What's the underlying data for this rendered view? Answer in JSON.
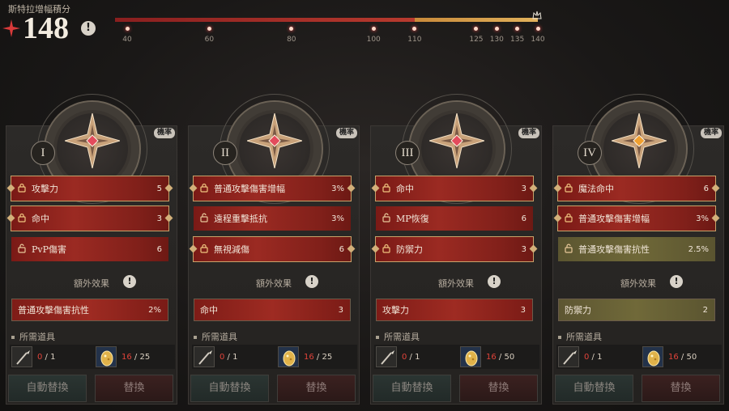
{
  "header": {
    "label": "斯特拉增幅積分",
    "score": "148",
    "info": "!",
    "end_icon": "crown-icon",
    "progress_total": 140,
    "progress_red_until": 110,
    "progress_gold_until": 140,
    "ticks": [
      {
        "label": "40",
        "value": 40
      },
      {
        "label": "60",
        "value": 60
      },
      {
        "label": "80",
        "value": 80
      },
      {
        "label": "100",
        "value": 100
      },
      {
        "label": "110",
        "value": 110
      },
      {
        "label": "125",
        "value": 125
      },
      {
        "label": "130",
        "value": 130
      },
      {
        "label": "135",
        "value": 135
      },
      {
        "label": "140",
        "value": 140
      }
    ],
    "colors": {
      "red": "#9b2a22",
      "gold": "#e2b25c"
    }
  },
  "panels": [
    {
      "roman": "I",
      "prob": "機率",
      "emblem_gem": "#e34b5c",
      "stats": [
        {
          "name": "攻擊力",
          "value": "5",
          "locked": true,
          "style": "red"
        },
        {
          "name": "命中",
          "value": "3",
          "locked": true,
          "style": "red"
        },
        {
          "name": "PvP傷害",
          "value": "6",
          "locked": false,
          "style": "red"
        }
      ],
      "extra_title": "額外效果",
      "extra": {
        "name": "普通攻擊傷害抗性",
        "value": "2%",
        "style": "red"
      },
      "req_title": "所需道具",
      "req": [
        {
          "have": "0",
          "need": "1",
          "icon": "spear-icon"
        },
        {
          "have": "16",
          "need": "25",
          "icon": "gold-egg-icon"
        }
      ],
      "auto_label": "自動替換",
      "swap_label": "替換"
    },
    {
      "roman": "II",
      "prob": "機率",
      "emblem_gem": "#e34b5c",
      "stats": [
        {
          "name": "普通攻擊傷害增幅",
          "value": "3%",
          "locked": true,
          "style": "red"
        },
        {
          "name": "遠程重擊抵抗",
          "value": "3%",
          "locked": false,
          "style": "red"
        },
        {
          "name": "無視減傷",
          "value": "6",
          "locked": true,
          "style": "red"
        }
      ],
      "extra_title": "額外效果",
      "extra": {
        "name": "命中",
        "value": "3",
        "style": "red"
      },
      "req_title": "所需道具",
      "req": [
        {
          "have": "0",
          "need": "1",
          "icon": "spear-icon"
        },
        {
          "have": "16",
          "need": "25",
          "icon": "gold-egg-icon"
        }
      ],
      "auto_label": "自動替換",
      "swap_label": "替換"
    },
    {
      "roman": "III",
      "prob": "機率",
      "emblem_gem": "#e34b5c",
      "stats": [
        {
          "name": "命中",
          "value": "3",
          "locked": true,
          "style": "red"
        },
        {
          "name": "MP恢復",
          "value": "6",
          "locked": false,
          "style": "red"
        },
        {
          "name": "防禦力",
          "value": "3",
          "locked": true,
          "style": "red"
        }
      ],
      "extra_title": "額外效果",
      "extra": {
        "name": "攻擊力",
        "value": "3",
        "style": "red"
      },
      "req_title": "所需道具",
      "req": [
        {
          "have": "0",
          "need": "1",
          "icon": "spear-icon"
        },
        {
          "have": "16",
          "need": "50",
          "icon": "gold-egg-icon"
        }
      ],
      "auto_label": "自動替換",
      "swap_label": "替換"
    },
    {
      "roman": "IV",
      "prob": "機率",
      "emblem_gem": "#f0a030",
      "stats": [
        {
          "name": "魔法命中",
          "value": "6",
          "locked": true,
          "style": "red"
        },
        {
          "name": "普通攻擊傷害增幅",
          "value": "3%",
          "locked": true,
          "style": "red"
        },
        {
          "name": "普通攻擊傷害抗性",
          "value": "2.5%",
          "locked": false,
          "style": "gold"
        }
      ],
      "extra_title": "額外效果",
      "extra": {
        "name": "防禦力",
        "value": "2",
        "style": "gold"
      },
      "req_title": "所需道具",
      "req": [
        {
          "have": "0",
          "need": "1",
          "icon": "spear-icon"
        },
        {
          "have": "16",
          "need": "50",
          "icon": "gold-egg-icon"
        }
      ],
      "auto_label": "自動替換",
      "swap_label": "替換"
    }
  ]
}
